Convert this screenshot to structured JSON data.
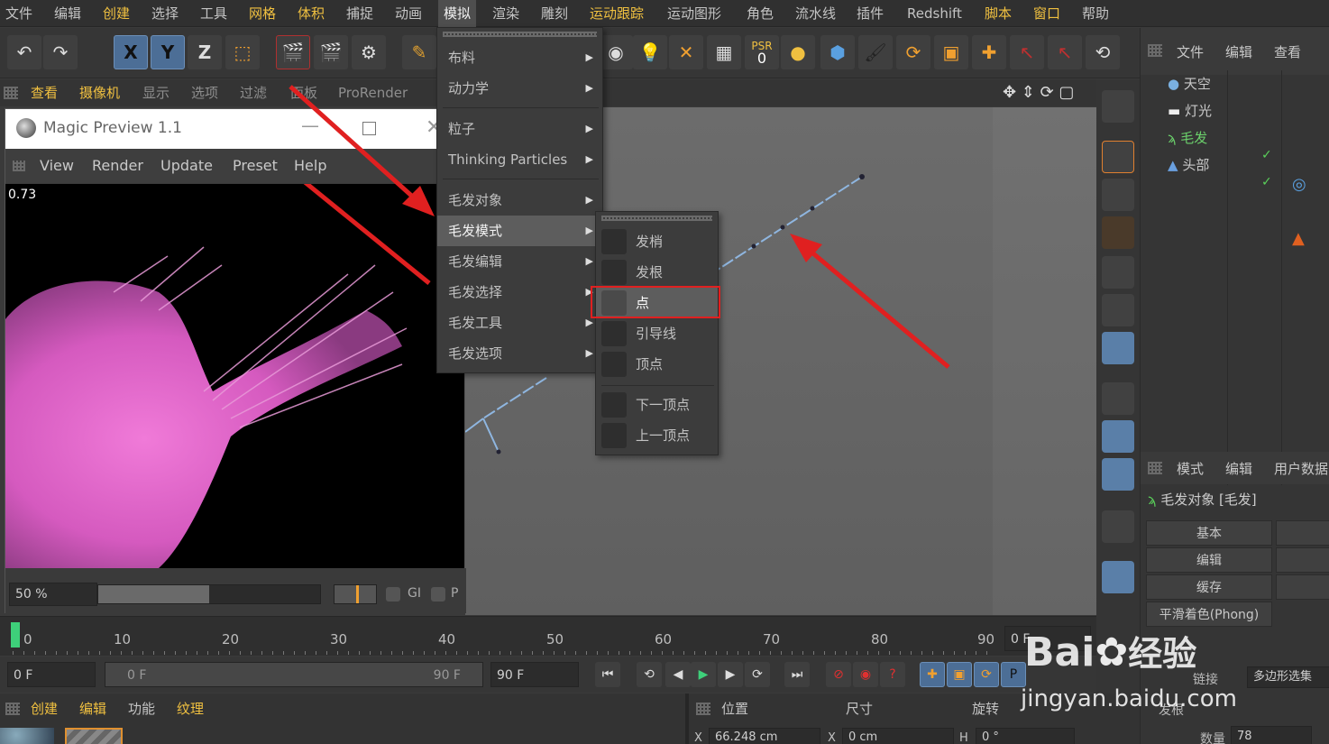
{
  "menubar": {
    "items": [
      "文件",
      "编辑",
      "创建",
      "选择",
      "工具",
      "网格",
      "体积",
      "捕捉",
      "动画",
      "模拟",
      "渲染",
      "雕刻",
      "运动跟踪",
      "运动图形",
      "角色",
      "流水线",
      "插件",
      "Redshift",
      "脚本",
      "窗口",
      "帮助"
    ],
    "active": "模拟"
  },
  "toolbar": {
    "axis_x": "X",
    "axis_y": "Y",
    "axis_z": "Z",
    "psr_label": "PSR",
    "psr_value": "0"
  },
  "viewport_header": {
    "items": [
      "查看",
      "摄像机",
      "显示",
      "选项",
      "过滤",
      "面板",
      "ProRender"
    ]
  },
  "magic_preview": {
    "title": "Magic Preview 1.1",
    "menu": [
      "View",
      "Render",
      "Update",
      "Preset",
      "Help"
    ],
    "render_time": "0.73",
    "zoom": "50 %",
    "gi_label": "GI",
    "p_label": "P",
    "progress": 0.5
  },
  "simulate_menu": {
    "items": [
      {
        "label": "布料",
        "sub": true
      },
      {
        "label": "动力学",
        "sub": true
      },
      {
        "label": "粒子",
        "sub": true
      },
      {
        "label": "Thinking Particles",
        "sub": true
      },
      {
        "label": "毛发对象",
        "sub": true
      },
      {
        "label": "毛发模式",
        "sub": true,
        "highlight": true
      },
      {
        "label": "毛发编辑",
        "sub": true
      },
      {
        "label": "毛发选择",
        "sub": true
      },
      {
        "label": "毛发工具",
        "sub": true
      },
      {
        "label": "毛发选项",
        "sub": true
      }
    ]
  },
  "hair_mode_submenu": {
    "items": [
      "发梢",
      "发根",
      "点",
      "引导线",
      "顶点",
      "下一顶点",
      "上一顶点"
    ],
    "selected": "点"
  },
  "object_manager": {
    "tabs": [
      "文件",
      "编辑",
      "查看"
    ],
    "objects": [
      "天空",
      "灯光",
      "毛发",
      "头部"
    ]
  },
  "attributes": {
    "tabs": [
      "模式",
      "编辑",
      "用户数据"
    ],
    "object_title": "毛发对象 [毛发]",
    "buttons": [
      "基本",
      "编辑",
      "缓存"
    ],
    "phong": "平滑着色(Phong)",
    "link_label": "链接",
    "link_value": "多边形选集",
    "guides_label": "发根",
    "count_label": "数量",
    "count_value": "78"
  },
  "timeline": {
    "ticks": [
      "0",
      "10",
      "20",
      "30",
      "40",
      "50",
      "60",
      "70",
      "80",
      "90"
    ],
    "end_field": "0 F"
  },
  "transport": {
    "current": "0 F",
    "range_start": "0 F",
    "range_end": "90 F",
    "max": "90 F"
  },
  "bottom_panel": {
    "material_tabs": [
      "创建",
      "编辑",
      "功能",
      "纹理"
    ],
    "coord_headers": [
      "位置",
      "尺寸",
      "旋转"
    ],
    "x_pos": "66.248 cm",
    "x_size": "0 cm",
    "h_rot": "0 °",
    "x_label": "X",
    "h_label": "H"
  },
  "watermark": {
    "brand": "Bai",
    "brand2": "经验",
    "url": "jingyan.baidu.com"
  },
  "colors": {
    "accent_red": "#e02020",
    "menu_bg": "#3c3c3c",
    "highlight": "#5d5d5d",
    "axis_blue": "#4c6e96",
    "hair_pink": "#e070d0"
  }
}
